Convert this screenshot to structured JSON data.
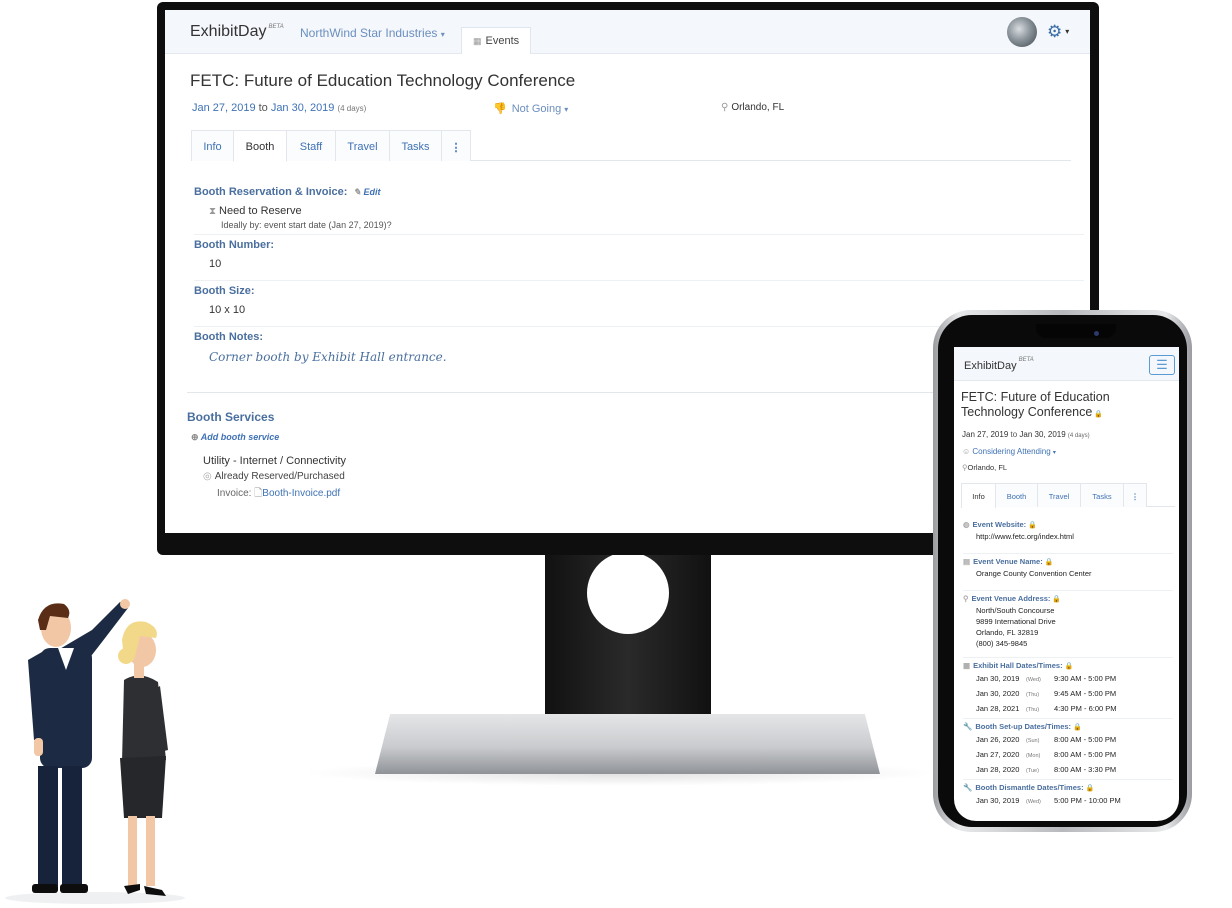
{
  "desktop": {
    "brand": "ExhibitDay",
    "brand_badge": "BETA",
    "org": "NorthWind Star Industries",
    "events_tab": "Events",
    "event_title": "FETC: Future of Education Technology Conference",
    "date_start": "Jan 27, 2019",
    "date_to": "to",
    "date_end": "Jan 30, 2019",
    "duration": "(4 days)",
    "attendance": "Not Going",
    "location": "Orlando, FL",
    "tabs": [
      "Info",
      "Booth",
      "Staff",
      "Travel",
      "Tasks",
      "⋮"
    ],
    "booth": {
      "reservation_label": "Booth Reservation & Invoice:",
      "edit_label": "Edit",
      "reservation_status": "Need to Reserve",
      "ideally_by": "Ideally by: event start date (Jan 27, 2019)?",
      "number_label": "Booth Number:",
      "number_value": "10",
      "size_label": "Booth Size:",
      "size_value": "10 x 10",
      "notes_label": "Booth Notes:",
      "notes_value": "Corner booth by Exhibit Hall entrance."
    },
    "services": {
      "title": "Booth Services",
      "add_label": "Add booth service",
      "item_name": "Utility - Internet / Connectivity",
      "item_status": "Already Reserved/Purchased",
      "invoice_label": "Invoice:",
      "invoice_file": "Booth-Invoice.pdf"
    }
  },
  "mobile": {
    "brand": "ExhibitDay",
    "brand_badge": "BETA",
    "event_title": "FETC: Future of Education Technology Conference",
    "date_start": "Jan 27, 2019",
    "date_to": "to",
    "date_end": "Jan 30, 2019",
    "duration": "(4 days)",
    "attendance": "Considering Attending",
    "location": "Orlando, FL",
    "tabs": [
      "Info",
      "Booth",
      "Travel",
      "Tasks",
      "⋮"
    ],
    "website_label": "Event Website:",
    "website_value": "http://www.fetc.org/index.html",
    "venue_label": "Event Venue Name:",
    "venue_value": "Orange County Convention Center",
    "address_label": "Event Venue Address:",
    "address_lines": [
      "North/South Concourse",
      "9899 International Drive",
      "Orlando, FL 32819",
      "(800) 345-9845"
    ],
    "hall_label": "Exhibit Hall Dates/Times:",
    "hall_rows": [
      {
        "date": "Jan 30, 2019",
        "dow": "(Wed)",
        "time": "9:30 AM - 5:00 PM"
      },
      {
        "date": "Jan 30, 2020",
        "dow": "(Thu)",
        "time": "9:45 AM - 5:00 PM"
      },
      {
        "date": "Jan 28, 2021",
        "dow": "(Thu)",
        "time": "4:30 PM - 6:00 PM"
      }
    ],
    "setup_label": "Booth Set-up Dates/Times:",
    "setup_rows": [
      {
        "date": "Jan 26, 2020",
        "dow": "(Sun)",
        "time": "8:00 AM - 5:00 PM"
      },
      {
        "date": "Jan 27, 2020",
        "dow": "(Mon)",
        "time": "8:00 AM - 5:00 PM"
      },
      {
        "date": "Jan 28, 2020",
        "dow": "(Tue)",
        "time": "8:00 AM - 3:30 PM"
      }
    ],
    "dismantle_label": "Booth Dismantle Dates/Times:",
    "dismantle_rows": [
      {
        "date": "Jan 30, 2019",
        "dow": "(Wed)",
        "time": "5:00 PM - 10:00 PM"
      }
    ]
  },
  "colors": {
    "link": "#3f72b5",
    "label": "#4a6f9e",
    "topbar": "#f4f7fb"
  }
}
